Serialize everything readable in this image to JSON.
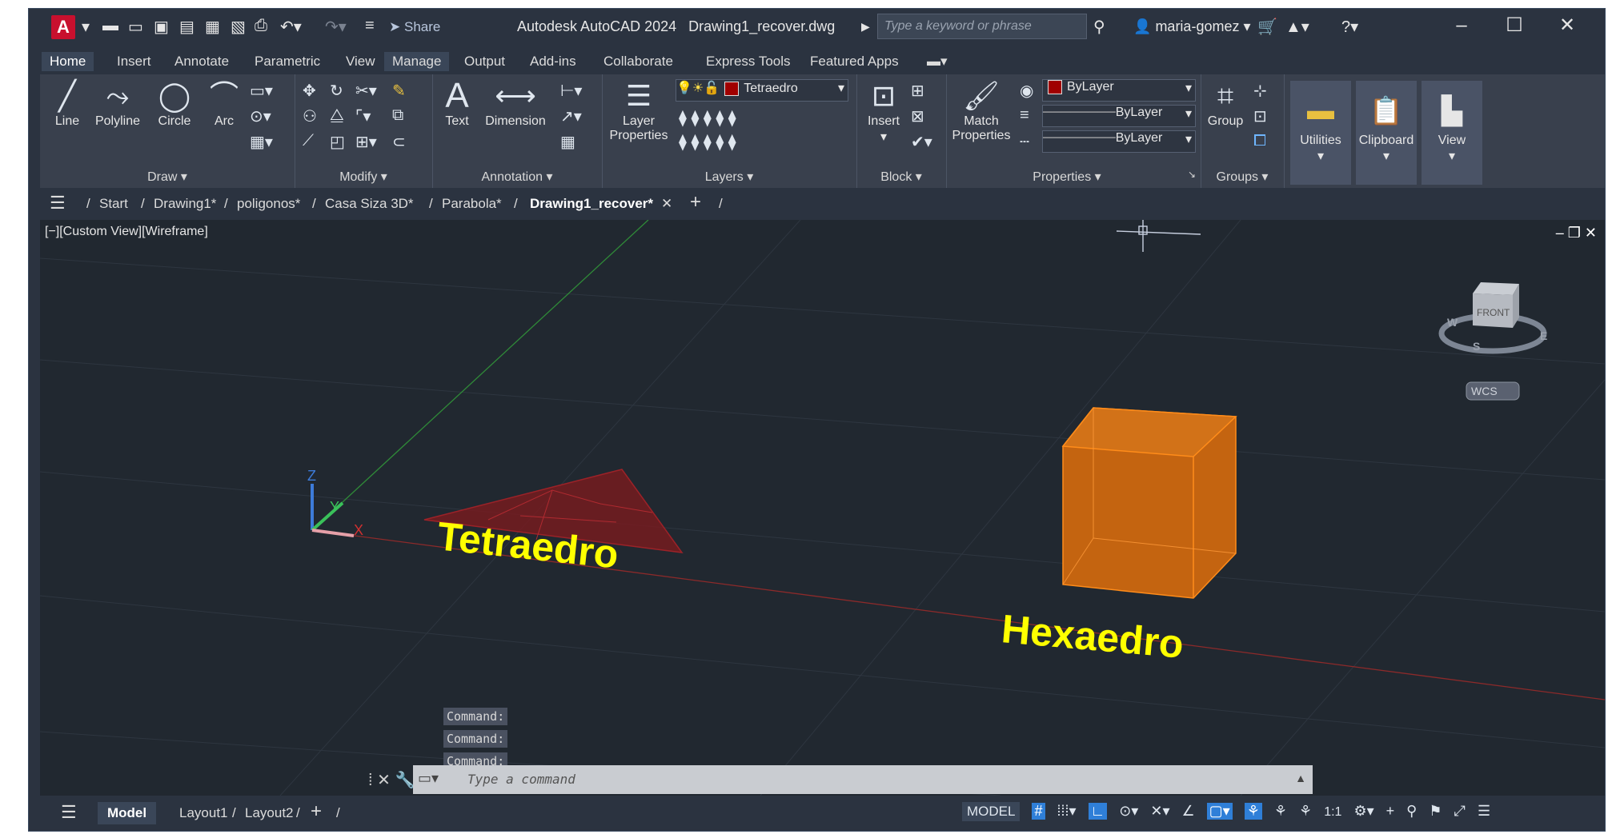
{
  "app": {
    "title": "Autodesk AutoCAD 2024",
    "file": "Drawing1_recover.dwg",
    "share": "Share",
    "search_placeholder": "Type a keyword or phrase",
    "user": "maria-gomez"
  },
  "ribbon_tabs": [
    "Home",
    "Insert",
    "Annotate",
    "Parametric",
    "View",
    "Manage",
    "Output",
    "Add-ins",
    "Collaborate",
    "Express Tools",
    "Featured Apps"
  ],
  "panels": {
    "draw": {
      "label": "Draw",
      "tools": [
        "Line",
        "Polyline",
        "Circle",
        "Arc"
      ]
    },
    "modify": {
      "label": "Modify"
    },
    "annotation": {
      "label": "Annotation",
      "tools": [
        "Text",
        "Dimension"
      ]
    },
    "layers": {
      "label": "Layers",
      "layer_properties": "Layer Properties",
      "current_layer": "Tetraedro"
    },
    "block": {
      "label": "Block",
      "insert": "Insert"
    },
    "properties": {
      "label": "Properties",
      "match": "Match Properties",
      "color": "ByLayer",
      "linetype": "ByLayer",
      "lineweight": "ByLayer"
    },
    "groups": {
      "label": "Groups",
      "group": "Group"
    },
    "utilities": "Utilities",
    "clipboard": "Clipboard",
    "view": "View"
  },
  "file_tabs": [
    "Start",
    "Drawing1*",
    "poligonos*",
    "Casa Siza 3D*",
    "Parabola*",
    "Drawing1_recover*"
  ],
  "viewport": {
    "label": "[−][Custom View][Wireframe]",
    "labels_3d": [
      "Tetraedro",
      "Hexaedro"
    ],
    "viewcube_face": "FRONT",
    "wcs": "WCS",
    "axis_labels": [
      "Z",
      "Y",
      "X"
    ],
    "compass_letters": [
      "W",
      "S",
      "E"
    ]
  },
  "command": {
    "history": [
      "Command:",
      "Command:",
      "Command:"
    ],
    "placeholder": "Type a command"
  },
  "layout_tabs": [
    "Model",
    "Layout1",
    "Layout2"
  ],
  "status": {
    "mode": "MODEL",
    "scale": "1:1"
  }
}
